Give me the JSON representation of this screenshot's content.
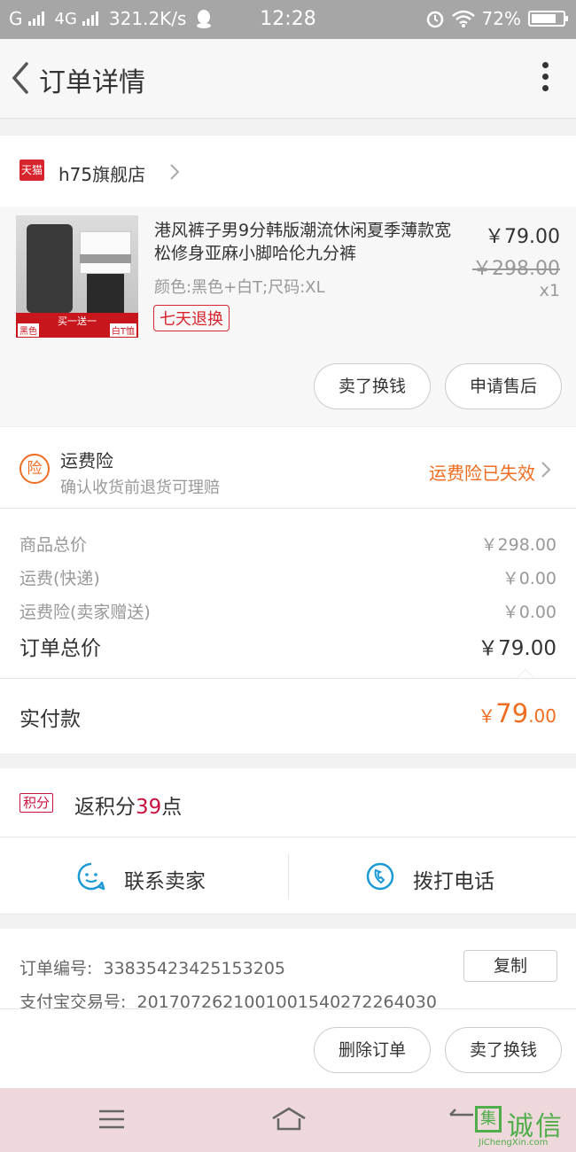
{
  "status": {
    "carrier1": "G",
    "carrier2": "4G",
    "speed": "321.2K/s",
    "time": "12:28",
    "battery": "72%"
  },
  "header": {
    "title": "订单详情"
  },
  "shop": {
    "badge": "天猫",
    "name": "h75旗舰店"
  },
  "product": {
    "title": "港风裤子男9分韩版潮流休闲夏季薄款宽松修身亚麻小脚哈伦九分裤",
    "spec": "颜色:黑色+白T;尺码:XL",
    "tag": "七天退换",
    "price": "￥79.00",
    "original_price": "￥298.00",
    "quantity": "x1",
    "image_promo": "买一送一",
    "image_left_label": "黑色",
    "image_right_label": "白T恤",
    "sell_button": "卖了换钱",
    "aftersale_button": "申请售后"
  },
  "insurance": {
    "icon": "险",
    "title": "运费险",
    "subtitle": "确认收货前退货可理赔",
    "status": "运费险已失效"
  },
  "summary": {
    "rows": [
      {
        "label": "商品总价",
        "value": "￥298.00"
      },
      {
        "label": "运费(快递)",
        "value": "￥0.00"
      },
      {
        "label": "运费险(卖家赠送)",
        "value": "￥0.00"
      }
    ],
    "total_label": "订单总价",
    "total_value": "￥79.00",
    "paid_label": "实付款",
    "paid_currency": "￥",
    "paid_int": "79",
    "paid_dec": ".00"
  },
  "points": {
    "badge": "积分",
    "prefix": "返积分",
    "value": "39",
    "suffix": "点"
  },
  "contact": {
    "seller": "联系卖家",
    "phone": "拨打电话"
  },
  "order_info": {
    "order_no_label": "订单编号:",
    "order_no": "33835423425153205",
    "copy_button": "复制",
    "alipay_label": "支付宝交易号:",
    "alipay_no": "2017072621001001540272264030"
  },
  "bottom": {
    "delete_button": "删除订单",
    "sell_button": "卖了换钱"
  },
  "watermark": {
    "char": "集",
    "text": "诚信",
    "url": "JiChengXin.com"
  },
  "colors": {
    "accent": "#ef6d20",
    "tmall": "#d8242c",
    "points": "#c7133f"
  }
}
